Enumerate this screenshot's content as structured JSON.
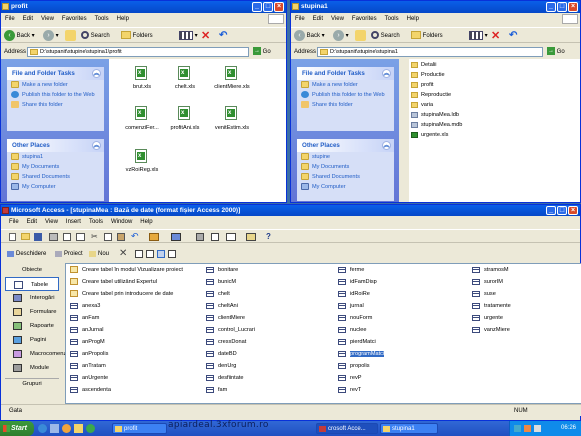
{
  "left_window": {
    "title": "profit",
    "menu": [
      "File",
      "Edit",
      "View",
      "Favorites",
      "Tools",
      "Help"
    ],
    "back_label": "Back",
    "search_label": "Search",
    "folders_label": "Folders",
    "address_label": "Address",
    "address_value": "D:\\stupanit\\stupine\\stupina1\\profit",
    "go_label": "Go",
    "tasks_title": "File and Folder Tasks",
    "tasks": [
      "Make a new folder",
      "Publish this folder to the Web",
      "Share this folder"
    ],
    "other_title": "Other Places",
    "places": [
      "stupina1",
      "My Documents",
      "Shared Documents",
      "My Computer"
    ],
    "files": [
      "brut.xls",
      "chelt.xls",
      "clientMiere.xls",
      "comenziFer...",
      "profitAni.xls",
      "venitEstim.xls",
      "vzRoiReg.xls"
    ]
  },
  "right_window": {
    "title": "stupina1",
    "menu": [
      "File",
      "Edit",
      "View",
      "Favorites",
      "Tools",
      "Help"
    ],
    "back_label": "Back",
    "search_label": "Search",
    "folders_label": "Folders",
    "address_label": "Address",
    "address_value": "D:\\stupanit\\stupine\\stupina1",
    "go_label": "Go",
    "tasks_title": "File and Folder Tasks",
    "tasks": [
      "Make a new folder",
      "Publish this folder to the Web",
      "Share this folder"
    ],
    "other_title": "Other Places",
    "places": [
      "stupine",
      "My Documents",
      "Shared Documents",
      "My Computer"
    ],
    "items": [
      {
        "name": "Detalii",
        "kind": "folder"
      },
      {
        "name": "Productie",
        "kind": "folder"
      },
      {
        "name": "profit",
        "kind": "folder"
      },
      {
        "name": "Reproductie",
        "kind": "folder"
      },
      {
        "name": "varia",
        "kind": "folder"
      },
      {
        "name": "stupinaMea.ldb",
        "kind": "db"
      },
      {
        "name": "stupinaMea.mdb",
        "kind": "db"
      },
      {
        "name": "urgente.xls",
        "kind": "xls"
      }
    ]
  },
  "access": {
    "title": "Microsoft Access - [stupinaMea : Bază de date (format fișier Access 2000)]",
    "menu": [
      "File",
      "Edit",
      "View",
      "Insert",
      "Tools",
      "Window",
      "Help"
    ],
    "open_label": "Deschidere",
    "design_label": "Proiect",
    "new_label": "Nou",
    "objects_header": "Obiecte",
    "objects": [
      "Tabele",
      "Interogări",
      "Formulare",
      "Rapoarte",
      "Pagini",
      "Macrocomenzi",
      "Module"
    ],
    "groups_label": "Grupuri",
    "tables": [
      [
        "Creare tabel în modul Vizualizare proiect",
        "Creare tabel utilizând Expertul",
        "Creare tabel prin introducere de date",
        "anexa3",
        "anFam",
        "anJurnal",
        "anProgM",
        "anPropolis",
        "anTratam",
        "anUrgente",
        "ascendenta"
      ],
      [
        "bonitare",
        "bunicM",
        "chelt",
        "cheltAni",
        "clientMiere",
        "control_Lucrari",
        "cresxDonat",
        "dateBD",
        "denUrg",
        "desfiintate",
        "fam"
      ],
      [
        "ferme",
        "idFamDisp",
        "idRoiRe",
        "jurnal",
        "nouForm",
        "nuclee",
        "pierdMatci",
        "programMatci",
        "propolis",
        "revP",
        "revT"
      ],
      [
        "stramosM",
        "surorIM",
        "suse",
        "tratamente",
        "urgente",
        "vanzMiere"
      ]
    ],
    "selected_table": "programMatci",
    "status_text": "Gata",
    "num_indicator": "NUM"
  },
  "taskbar": {
    "start_label": "Start",
    "items": [
      "",
      "profit",
      "",
      "crosoft Acce...",
      "stupina1"
    ],
    "clock": "06:26"
  },
  "watermark": "apiardeal.3xforum.ro"
}
